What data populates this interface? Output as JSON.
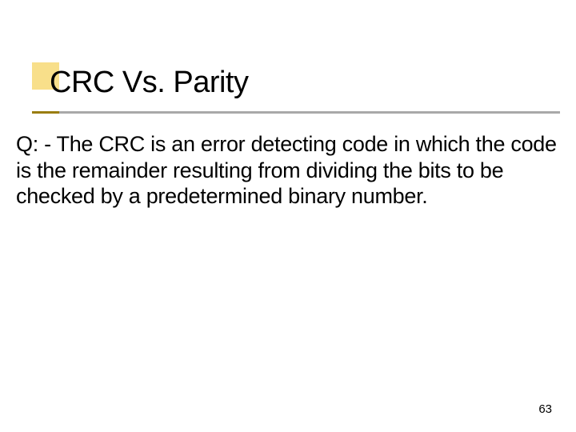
{
  "slide": {
    "title": "CRC Vs. Parity",
    "body": "Q: - The CRC is an error detecting code in which the code is the remainder resulting from dividing the bits to be checked by a predetermined binary number.",
    "pageNumber": "63"
  }
}
